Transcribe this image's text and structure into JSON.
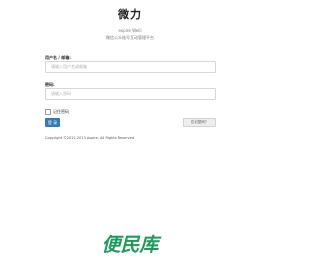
{
  "header": {
    "title": "微力",
    "subtitle_line1": "expire Weili",
    "subtitle_line2": "微信公众账号互动管理平台"
  },
  "form": {
    "username_label": "用户名 / 邮箱:",
    "username_placeholder": "请输入用户名或邮箱",
    "password_label": "密码:",
    "password_placeholder": "请输入密码",
    "remember_label": "记住密码",
    "login_button": "登 录",
    "forgot_button": "忘记密码？"
  },
  "footer": {
    "copyright": "Copyright ©2012-2013 Aspire. All Rights Reserved"
  },
  "watermark": {
    "text": "便民库"
  },
  "colors": {
    "primary_button": "#337ab7",
    "watermark": "#1e9a5a"
  }
}
